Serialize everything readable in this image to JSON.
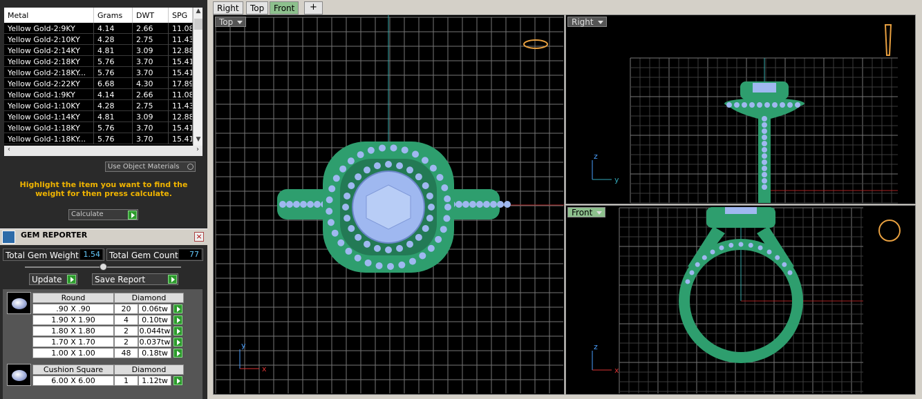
{
  "metal_table": {
    "headers": [
      "Metal",
      "Grams",
      "DWT",
      "SPG"
    ],
    "rows": [
      [
        "Yellow Gold-2:9KY",
        "4.14",
        "2.66",
        "11.08"
      ],
      [
        "Yellow Gold-2:10KY",
        "4.28",
        "2.75",
        "11.43"
      ],
      [
        "Yellow Gold-2:14KY",
        "4.81",
        "3.09",
        "12.88"
      ],
      [
        "Yellow Gold-2:18KY",
        "5.76",
        "3.70",
        "15.41"
      ],
      [
        "Yellow Gold-2:18KY...",
        "5.76",
        "3.70",
        "15.41"
      ],
      [
        "Yellow Gold-2:22KY",
        "6.68",
        "4.30",
        "17.89"
      ],
      [
        "Yellow Gold-1:9KY",
        "4.14",
        "2.66",
        "11.08"
      ],
      [
        "Yellow Gold-1:10KY",
        "4.28",
        "2.75",
        "11.43"
      ],
      [
        "Yellow Gold-1:14KY",
        "4.81",
        "3.09",
        "12.88"
      ],
      [
        "Yellow Gold-1:18KY",
        "5.76",
        "3.70",
        "15.41"
      ],
      [
        "Yellow Gold-1:18KY...",
        "5.76",
        "3.70",
        "15.41"
      ]
    ]
  },
  "use_object_materials": "Use Object Materials",
  "hint": "Highlight the item you want to find the weight for then press calculate.",
  "calculate_label": "Calculate",
  "gem_reporter": {
    "title": "GEM REPORTER",
    "total_weight_label": "Total Gem Weight",
    "total_weight_value": "1.54",
    "total_count_label": "Total Gem Count",
    "total_count_value": "77",
    "update_label": "Update",
    "save_label": "Save Report",
    "groups": [
      {
        "shape": "Round",
        "material": "Diamond",
        "rows": [
          [
            "​.90 X .90",
            "20",
            "0.06tw"
          ],
          [
            "1.90 X 1.90",
            "4",
            "0.10tw"
          ],
          [
            "1.80 X 1.80",
            "2",
            "0.044tw"
          ],
          [
            "1.70 X 1.70",
            "2",
            "0.037tw"
          ],
          [
            "1.00 X 1.00",
            "48",
            "0.18tw"
          ]
        ]
      },
      {
        "shape": "Cushion Square",
        "material": "Diamond",
        "rows": [
          [
            "6.00 X 6.00",
            "1",
            "1.12tw"
          ]
        ]
      }
    ]
  },
  "view_tabs": [
    "Right",
    "Top",
    "Front"
  ],
  "add_tab_icon": "plus-icon",
  "viewports": {
    "top": {
      "label": "Top",
      "axis_a": "y",
      "axis_b": "x"
    },
    "right": {
      "label": "Right",
      "axis_a": "z",
      "axis_b": "y"
    },
    "front": {
      "label": "Front",
      "axis_a": "z",
      "axis_b": "x"
    }
  },
  "colors": {
    "ring": "#2e9e6e",
    "gem": "#9fb8f0",
    "grid": "#4a4a4a",
    "accent_tab": "#8dc08d"
  }
}
